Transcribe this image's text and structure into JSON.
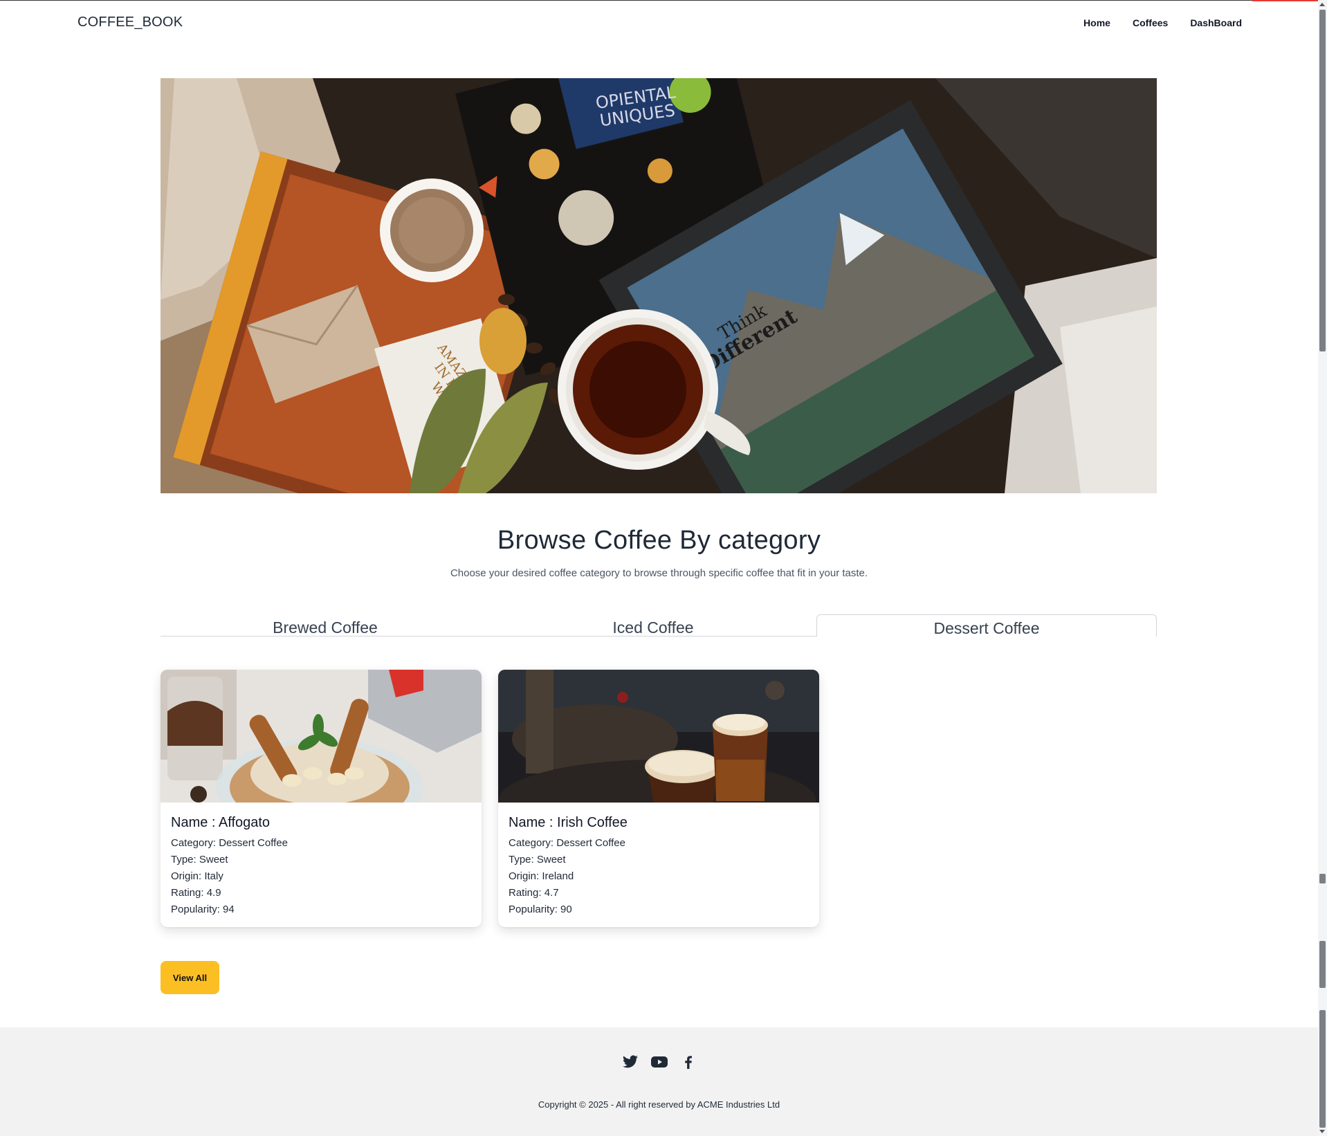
{
  "navbar": {
    "brand": "COFFEE_BOOK",
    "links": [
      "Home",
      "Coffees",
      "DashBoard"
    ]
  },
  "hero": {
    "alt": "Coffee cups on notebooks",
    "card_texts": [
      "AMAZING IN EVERY WAY...",
      "Think Different",
      "OPIENTAL UNIQUES"
    ]
  },
  "browse": {
    "title": "Browse Coffee By category",
    "subtitle": "Choose your desired coffee category to browse through specific coffee that fit in your taste.",
    "tabs": [
      "Brewed Coffee",
      "Iced Coffee",
      "Dessert Coffee"
    ],
    "active_tab": "Dessert Coffee"
  },
  "cards": [
    {
      "name": "Name : Affogato",
      "category": "Category: Dessert Coffee",
      "type": "Type: Sweet",
      "origin": "Origin: Italy",
      "rating": "Rating: 4.9",
      "popularity": "Popularity: 94"
    },
    {
      "name": "Name : Irish Coffee",
      "category": "Category: Dessert Coffee",
      "type": "Type: Sweet",
      "origin": "Origin: Ireland",
      "rating": "Rating: 4.7",
      "popularity": "Popularity: 90"
    }
  ],
  "view_all": "View All",
  "footer": {
    "social_icons": [
      "twitter-icon",
      "youtube-icon",
      "facebook-icon"
    ],
    "copyright": "Copyright © 2025 - All right reserved by ACME Industries Ltd"
  },
  "colors": {
    "accent_button": "#fbbf24",
    "footer_bg": "#f2f2f2",
    "text_dark": "#1f2937"
  }
}
